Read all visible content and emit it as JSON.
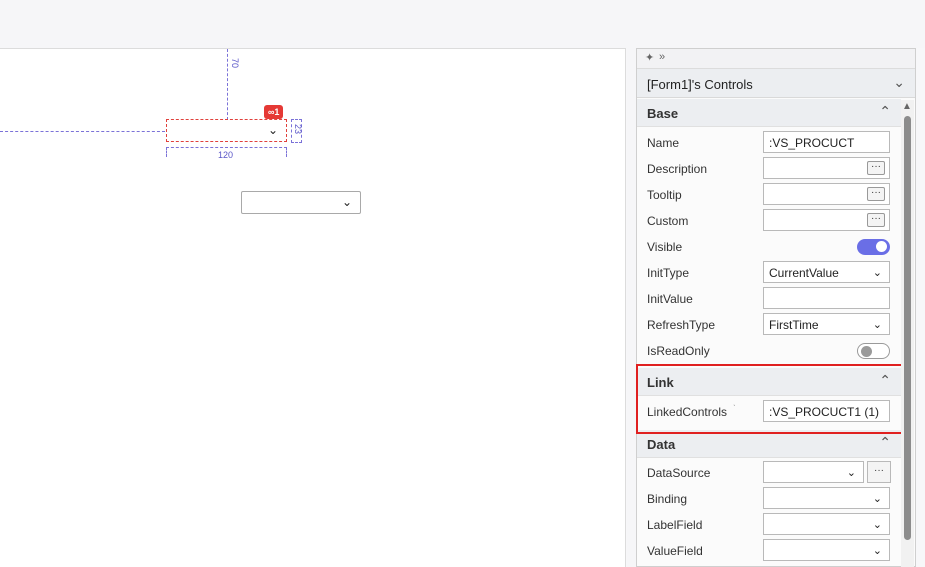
{
  "canvas": {
    "dim_top": "70",
    "dim_right": "23",
    "dim_bottom": "120",
    "badge": "∞1"
  },
  "panel": {
    "pin_icon": "pin-icon",
    "expand_icon": "double-chevron-right-icon",
    "title": "[Form1]'s Controls",
    "sections": {
      "base": "Base",
      "link": "Link",
      "data": "Data"
    },
    "rows": {
      "name": {
        "label": "Name",
        "value": ":VS_PROCUCT"
      },
      "description": {
        "label": "Description",
        "value": ""
      },
      "tooltip": {
        "label": "Tooltip",
        "value": ""
      },
      "custom": {
        "label": "Custom",
        "value": ""
      },
      "visible": {
        "label": "Visible"
      },
      "inittype": {
        "label": "InitType",
        "value": "CurrentValue"
      },
      "initvalue": {
        "label": "InitValue",
        "value": ""
      },
      "refreshtype": {
        "label": "RefreshType",
        "value": "FirstTime"
      },
      "isreadonly": {
        "label": "IsReadOnly"
      },
      "linkedcontrols": {
        "label": "LinkedControls",
        "value": ":VS_PROCUCT1  (1)"
      },
      "datasource": {
        "label": "DataSource",
        "value": ""
      },
      "binding": {
        "label": "Binding",
        "value": ""
      },
      "labelfield": {
        "label": "LabelField",
        "value": ""
      },
      "valuefield": {
        "label": "ValueField",
        "value": ""
      }
    },
    "dots": "···",
    "toggle_visible": true,
    "toggle_readonly": false
  },
  "colors": {
    "accent": "#6a6ee6",
    "highlight": "#e02020",
    "badge": "#e53935"
  }
}
